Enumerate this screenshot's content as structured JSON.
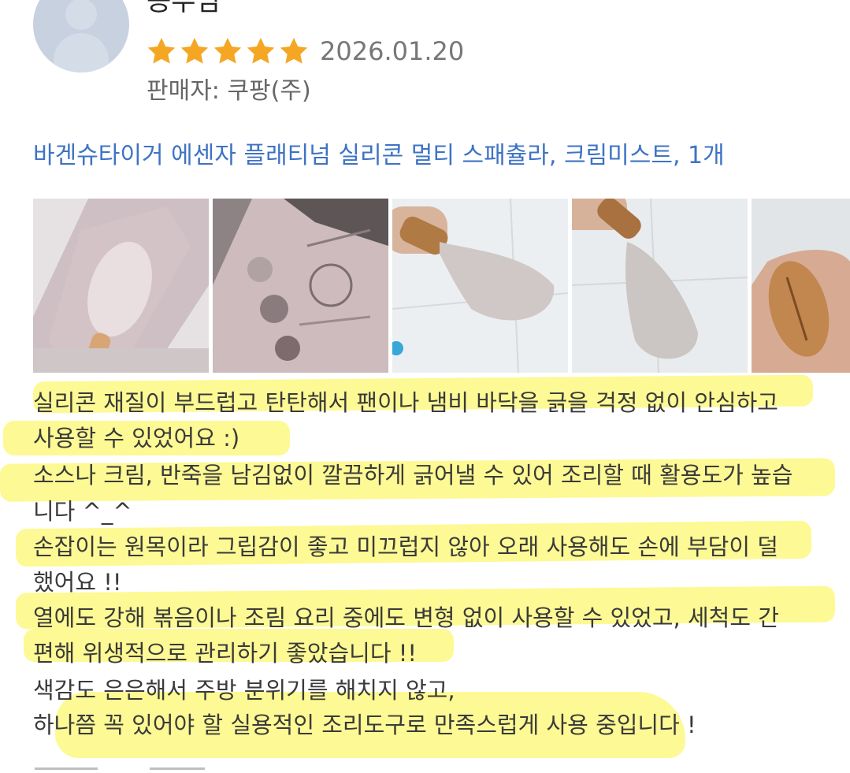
{
  "review": {
    "reviewer_name": "공주님",
    "rating": 5,
    "max_rating": 5,
    "date": "2026.01.20",
    "seller": "판매자: 쿠팡(주)",
    "product_name": "바겐슈타이거 에센자 플래티넘 실리콘 멀티 스패츌라, 크림미스트, 1개"
  },
  "photos": [
    {
      "icon": "spatula-box-front-photo"
    },
    {
      "icon": "spatula-box-back-photo"
    },
    {
      "icon": "spatula-in-hand-photo"
    },
    {
      "icon": "spatula-blade-photo"
    },
    {
      "icon": "spatula-handle-photo"
    }
  ],
  "body_lines": [
    "실리콘 재질이 부드럽고 탄탄해서 팬이나 냄비 바닥을 긁을 걱정 없이 안심하고",
    "사용할 수 있었어요 :)",
    "소스나 크림, 반죽을 남김없이 깔끔하게 긁어낼 수 있어 조리할 때 활용도가 높습",
    "니다 ^_^",
    "손잡이는 원목이라 그립감이 좋고 미끄럽지 않아 오래 사용해도 손에 부담이 덜",
    "했어요 !!",
    "열에도 강해 볶음이나 조림 요리 중에도 변형 없이 사용할 수 있었고, 세척도 간",
    "편해 위생적으로 관리하기 좋았습니다 !!",
    "색감도 은은해서 주방 분위기를 해치지 않고,",
    "하나쯤 꼭 있어야 할 실용적인 조리도구로 만족스럽게 사용 중입니다 !"
  ],
  "colors": {
    "star": "#f5a623",
    "link": "#3e73c4",
    "highlight": "#fcf65a",
    "avatar": "#c7d1e0"
  }
}
